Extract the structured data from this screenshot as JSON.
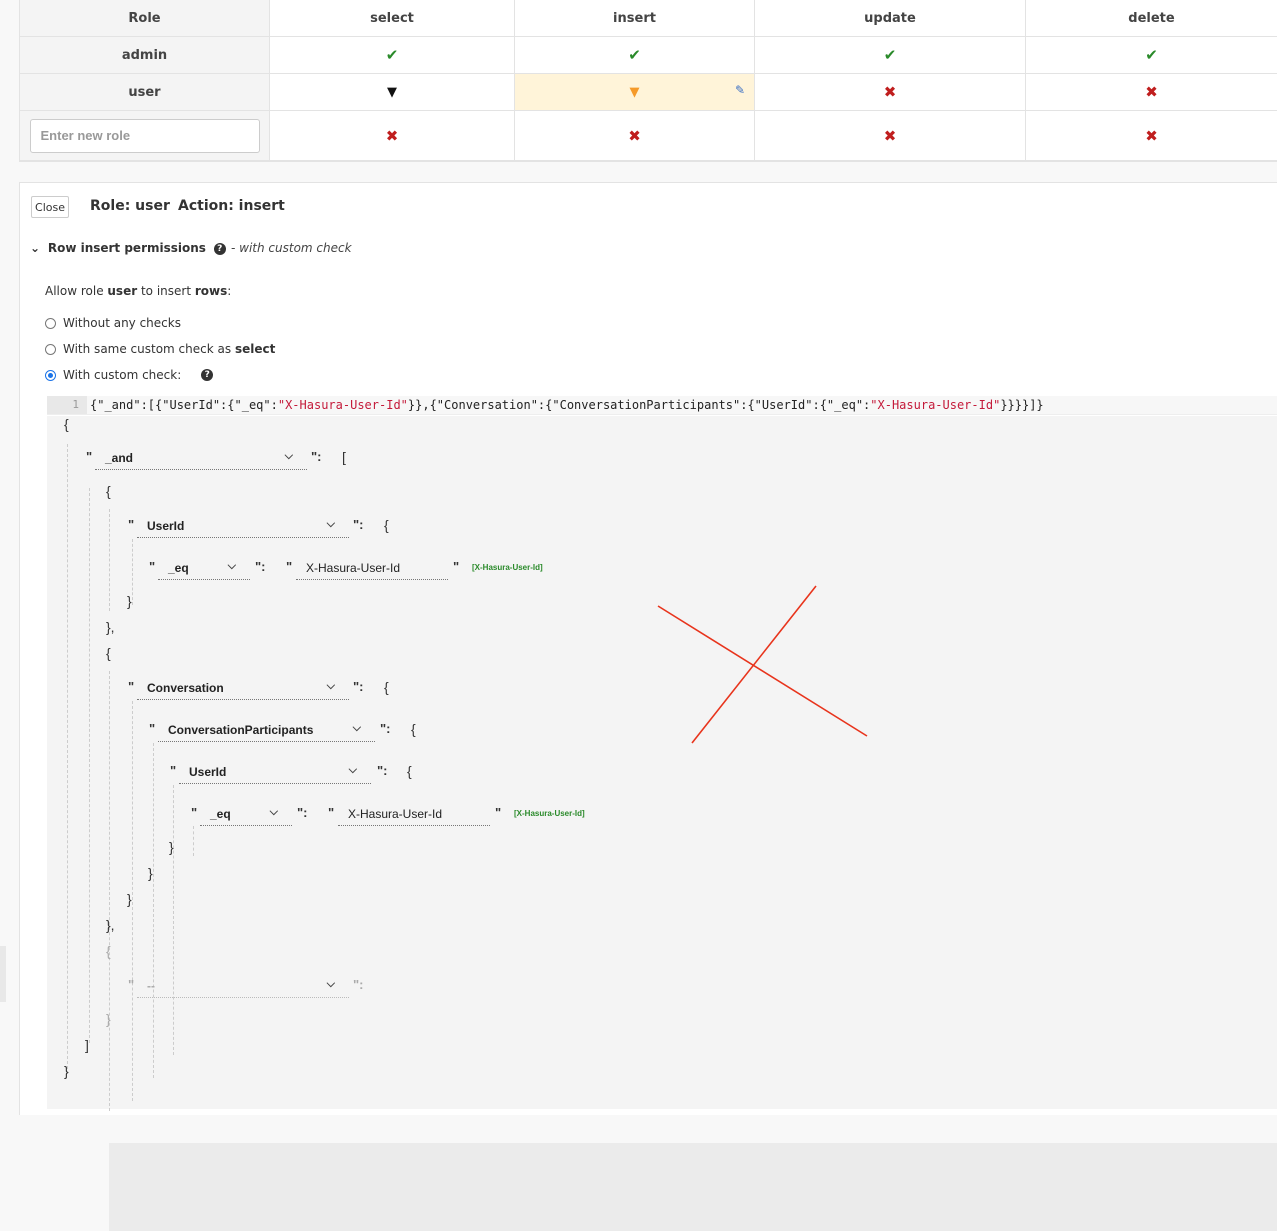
{
  "table": {
    "headers": [
      "Role",
      "select",
      "insert",
      "update",
      "delete"
    ],
    "rows": [
      {
        "role": "admin",
        "select": "check",
        "insert": "check",
        "update": "check",
        "delete": "check"
      },
      {
        "role": "user",
        "select": "filter",
        "insert": "filter-active",
        "update": "cross",
        "delete": "cross"
      }
    ],
    "new_role_placeholder": "Enter new role",
    "icons": {
      "check": "✔",
      "cross": "✖",
      "filter": "▼",
      "pencil": "✎"
    }
  },
  "panel": {
    "close_label": "Close",
    "role_title": "Role: user",
    "action_title": "Action: insert",
    "section_chevron": "⌄",
    "section_title": "Row insert permissions",
    "section_subtitle": "- with custom check",
    "allow_prefix": "Allow role ",
    "allow_role": "user",
    "allow_mid": " to insert ",
    "allow_rows": "rows",
    "allow_suffix": ":",
    "options": {
      "without": "Without any checks",
      "same_prefix": "With same custom check as ",
      "same_bold": "select",
      "custom": "With custom check:"
    },
    "selected_option": "custom",
    "help_icon": "?"
  },
  "code": {
    "line_number": "1",
    "segments": [
      {
        "t": "{\"_and\":[{\"UserId\":{\"_eq\":",
        "s": false
      },
      {
        "t": "\"X-Hasura-User-Id\"",
        "s": true
      },
      {
        "t": "}},{\"Conversation\":{\"ConversationParticipants\":{\"UserId\":{\"_eq\":",
        "s": false
      },
      {
        "t": "\"X-Hasura-User-Id\"",
        "s": true
      },
      {
        "t": "}}}}]}",
        "s": false
      }
    ]
  },
  "builder": {
    "open_brace": "{",
    "close_brace": "}",
    "open_bracket": "[",
    "close_bracket": "]",
    "quote": "\"",
    "colon": "\":",
    "and_key": "_and",
    "userid_key": "UserId",
    "eq_key": "_eq",
    "value": "X-Hasura-User-Id",
    "session_tag": "[X-Hasura-User-Id]",
    "conversation_key": "Conversation",
    "participants_key": "ConversationParticipants",
    "new_key_placeholder": "--",
    "close_obj_comma": "},",
    "chevron": "⌵"
  }
}
